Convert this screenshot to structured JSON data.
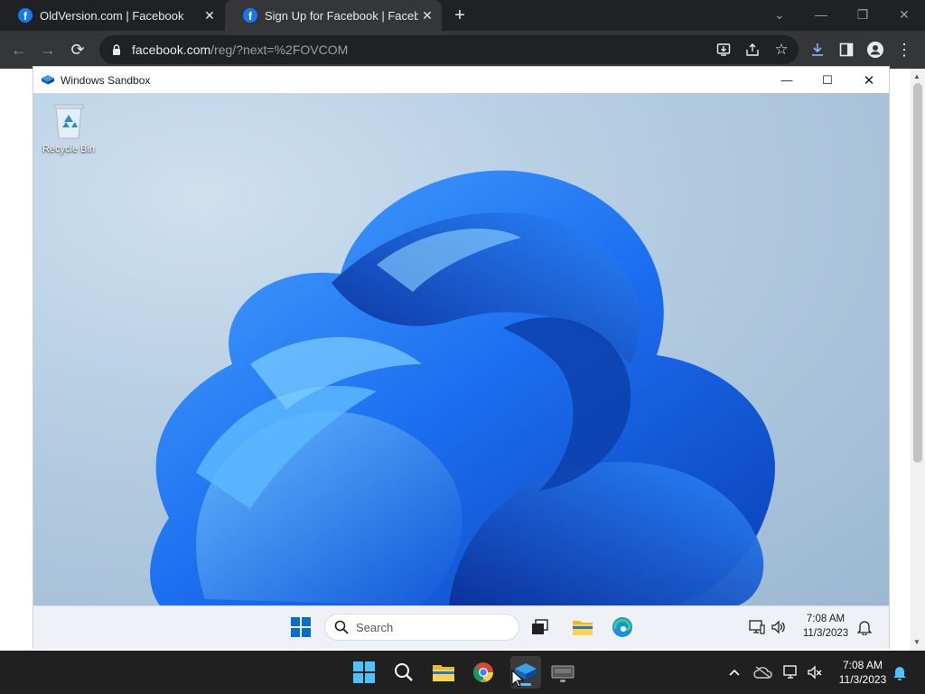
{
  "browser": {
    "tabs": [
      {
        "title": "OldVersion.com | Facebook",
        "active": false
      },
      {
        "title": "Sign Up for Facebook | Facebook",
        "active": true
      }
    ],
    "address": {
      "host": "facebook.com",
      "path": "/reg/?next=%2FOVCOM"
    }
  },
  "sandbox": {
    "title": "Windows Sandbox",
    "desktop_icons": [
      {
        "label": "Recycle Bin",
        "icon": "recycle-bin-icon"
      }
    ],
    "taskbar": {
      "search_placeholder": "Search",
      "time": "7:08 AM",
      "date": "11/3/2023"
    }
  },
  "host_taskbar": {
    "time": "7:08 AM",
    "date": "11/3/2023"
  },
  "colors": {
    "accent": "#1a73e8",
    "facebook": "#1877f2",
    "windows_blue": "#0a6ed1"
  }
}
